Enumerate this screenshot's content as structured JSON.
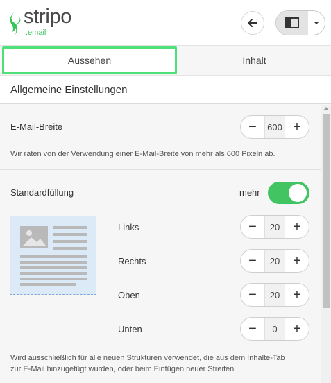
{
  "header": {
    "logo_word": "stripo",
    "logo_sub": ".email",
    "back_icon": "arrow-left-icon",
    "layout_icon": "panel-layout-icon",
    "caret_icon": "chevron-down-icon"
  },
  "tabs": [
    {
      "label": "Aussehen",
      "active": true
    },
    {
      "label": "Inhalt",
      "active": false
    }
  ],
  "section": {
    "title": "Allgemeine Einstellungen"
  },
  "email_width": {
    "label": "E-Mail-Breite",
    "value": "600",
    "minus": "−",
    "plus": "+",
    "hint": "Wir raten von der Verwendung einer E-Mail-Breite von mehr als 600 Pixeln ab."
  },
  "padding": {
    "label": "Standardfüllung",
    "more_label": "mehr",
    "more_on": true,
    "fields": [
      {
        "label": "Links",
        "value": "20"
      },
      {
        "label": "Rechts",
        "value": "20"
      },
      {
        "label": "Oben",
        "value": "20"
      },
      {
        "label": "Unten",
        "value": "0"
      }
    ],
    "minus": "−",
    "plus": "+",
    "note_line1": "Wird ausschließlich für alle neuen Strukturen verwendet, die aus dem Inhalte-Tab",
    "note_line2": "zur E-Mail hinzugefügt wurden, oder beim Einfügen neuer Streifen"
  },
  "colors": {
    "accent": "#43c463",
    "tab_outline": "#4fe07a",
    "logo_green": "#35c55a",
    "preview_bg": "#dce9f7"
  }
}
